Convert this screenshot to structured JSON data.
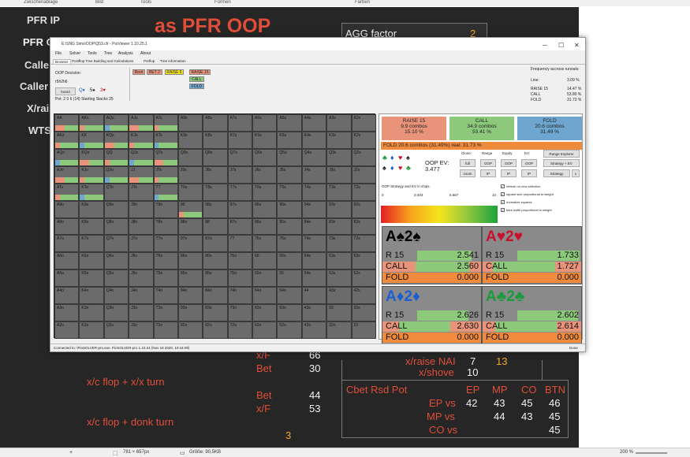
{
  "topbar": {
    "items": [
      "Zwischenablage",
      "Bild",
      "Tools",
      "Formen",
      "Farben"
    ]
  },
  "slide": {
    "title": "as PFR OOP",
    "agg_label": "AGG factor",
    "agg_value": "2",
    "left_items": [
      "PFR IP",
      "PFR OO",
      "Caller",
      "Caller O",
      "X/rais",
      "WTSD"
    ],
    "stats_left": [
      {
        "label": "x/F",
        "value": "66"
      },
      {
        "label": "Bet",
        "value": "30"
      }
    ],
    "stats_xc_xx": "x/c flop + x/x turn",
    "stats_left2": [
      {
        "label": "Bet",
        "value": "44"
      },
      {
        "label": "x/F",
        "value": "53"
      }
    ],
    "stats_donk": "x/c flop + donk turn",
    "stats_donk_value": "3",
    "raise_label": "x/raise NAI",
    "raise_v1": "7",
    "raise_v2": "13",
    "shove_label": "x/shove",
    "shove_value": "10",
    "cbet": {
      "title": "Cbet Rsd Pot",
      "cols": [
        "EP",
        "MP",
        "CO",
        "BTN"
      ],
      "rows": [
        {
          "label": "EP vs",
          "vals": [
            "42",
            "43",
            "45",
            "46"
          ]
        },
        {
          "label": "MP vs",
          "vals": [
            "",
            "44",
            "43",
            "45"
          ]
        },
        {
          "label": "CO vs",
          "vals": [
            "",
            "",
            "",
            "45"
          ]
        }
      ]
    }
  },
  "window": {
    "title": "E:\\SNG Sims\\OOP\\Q53.cfr - PioViewer 1.10.25.1",
    "menu": [
      "File",
      "Solver",
      "Tools",
      "Tree",
      "Analysis",
      "About"
    ],
    "tabs": [
      "Browser",
      "Postflop Tree Building and Calculations",
      "Preflop",
      "Tree information"
    ],
    "oop_decision": "OOP Decision:",
    "board": "r5h2h6",
    "load_btn": "board",
    "pot_info": "Pot: 2 0 6 (14) Starting Stacks 25",
    "nodes": [
      "Root",
      "BET 2",
      "RAISE 6",
      "RAISE 15"
    ],
    "sub_nodes": [
      "CALL",
      "FOLD"
    ],
    "freq_title": "Frequency accross runouts:",
    "freq_line": {
      "label": "Line:",
      "value": "3.09 %"
    },
    "freq": [
      {
        "label": "RAISE 15",
        "value": "14.47 %"
      },
      {
        "label": "CALL",
        "value": "53.80 %"
      },
      {
        "label": "FOLD",
        "value": "31.73 %"
      }
    ],
    "status": "Connected to: \\PioSOLVER-pro.exe. PioSOLVER-pro 1.10.24 (Nov 18 2020, 10:44:09)",
    "status_right": "Done"
  },
  "grid": {
    "ranks": [
      "A",
      "K",
      "Q",
      "J",
      "T",
      "9",
      "8",
      "7",
      "6",
      "5",
      "4",
      "3",
      "2"
    ]
  },
  "actions": {
    "raise": {
      "label": "RAISE 15",
      "combos": "9.9 combos",
      "pct": "15.10 %"
    },
    "call": {
      "label": "CALL",
      "combos": "34.9 combos",
      "pct": "53.41 %"
    },
    "fold": {
      "label": "FOLD",
      "combos": "20.6 combos",
      "pct": "31.49 %"
    },
    "fold_bar": "FOLD  20.6 combos (31.49%) real: 31.73 %",
    "col_headers": [
      "Clone:",
      "Range",
      "Equity",
      "EV:"
    ],
    "oop_ev_label": "OOP EV:",
    "oop_ev": "3.477",
    "btns": [
      "full",
      "OOP",
      "OOP",
      "OOP",
      "zoom",
      "IP",
      "IP",
      "IP"
    ],
    "range_explorer": "Range Explorer",
    "strat_ev": "Strategy + EV",
    "strategy": "Strategy",
    "strategy_x": "x",
    "grad_title": "OOP Strategy and EV in chips",
    "grad_ticks": [
      "0",
      "3.333",
      "6.667",
      "10"
    ],
    "checks": [
      "refresh on new selection",
      "square size proportional to weight",
      "normalize squares",
      "bars width proportional to weight"
    ]
  },
  "hands": [
    {
      "name": "A♠2♠",
      "color": "#000000",
      "r": "2.541",
      "c": "2.560",
      "f": "0.000",
      "rf": 0.26,
      "cf": 0.55,
      "ff": 0.19
    },
    {
      "name": "A♥2♥",
      "color": "#c8102e",
      "r": "1.733",
      "c": "1.727",
      "f": "0.000",
      "rf": 0.08,
      "cf": 0.63,
      "ff": 0.29
    },
    {
      "name": "A♦2♦",
      "color": "#1b5fd0",
      "r": "2.626",
      "c": "2.630",
      "f": "0.000",
      "rf": 0.13,
      "cf": 0.52,
      "ff": 0.35
    },
    {
      "name": "A♣2♣",
      "color": "#1a9b3c",
      "r": "2.602",
      "c": "2.614",
      "f": "0.000",
      "rf": 0.1,
      "cf": 0.62,
      "ff": 0.28
    }
  ],
  "hand_labels": {
    "r": "R 15",
    "c": "CALL",
    "f": "FOLD"
  },
  "statusbar": {
    "pos": "781 × 657px",
    "size": "Größe: 90,5KB",
    "zoom": "200 %"
  },
  "colors": {
    "raise": "#e8937a",
    "call": "#8cc97a",
    "fold": "#6fa6cf",
    "foldbar": "#f08a3c",
    "cell": "#6b6b6b"
  }
}
